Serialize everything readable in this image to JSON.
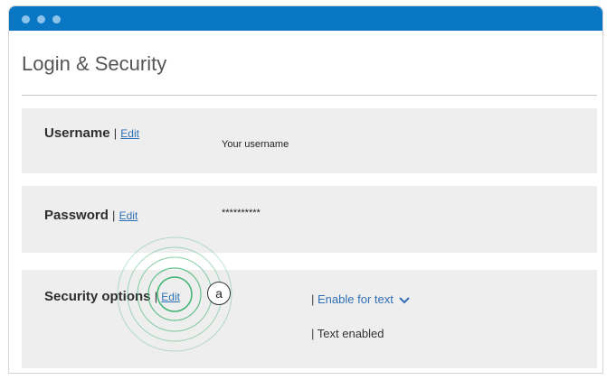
{
  "page": {
    "title": "Login & Security"
  },
  "username": {
    "label": "Username",
    "separator": "|",
    "edit_label": "Edit",
    "value": "Your username"
  },
  "password": {
    "label": "Password",
    "separator": "|",
    "edit_label": "Edit",
    "value": "**********"
  },
  "security": {
    "label": "Security options",
    "separator": "|",
    "edit_label": "Edit",
    "option_separator": "|",
    "enable_label": "Enable for text",
    "status_separator": "|",
    "status": "Text enabled"
  },
  "callout": {
    "label": "a"
  },
  "icons": {
    "dropdown": "chevron-down-icon",
    "highlight": "ripple-rings"
  },
  "colors": {
    "titlebar": "#0a77c4",
    "link": "#2e6fb5",
    "card_background": "#eeeeee",
    "highlight_ring": "#3cb371"
  }
}
